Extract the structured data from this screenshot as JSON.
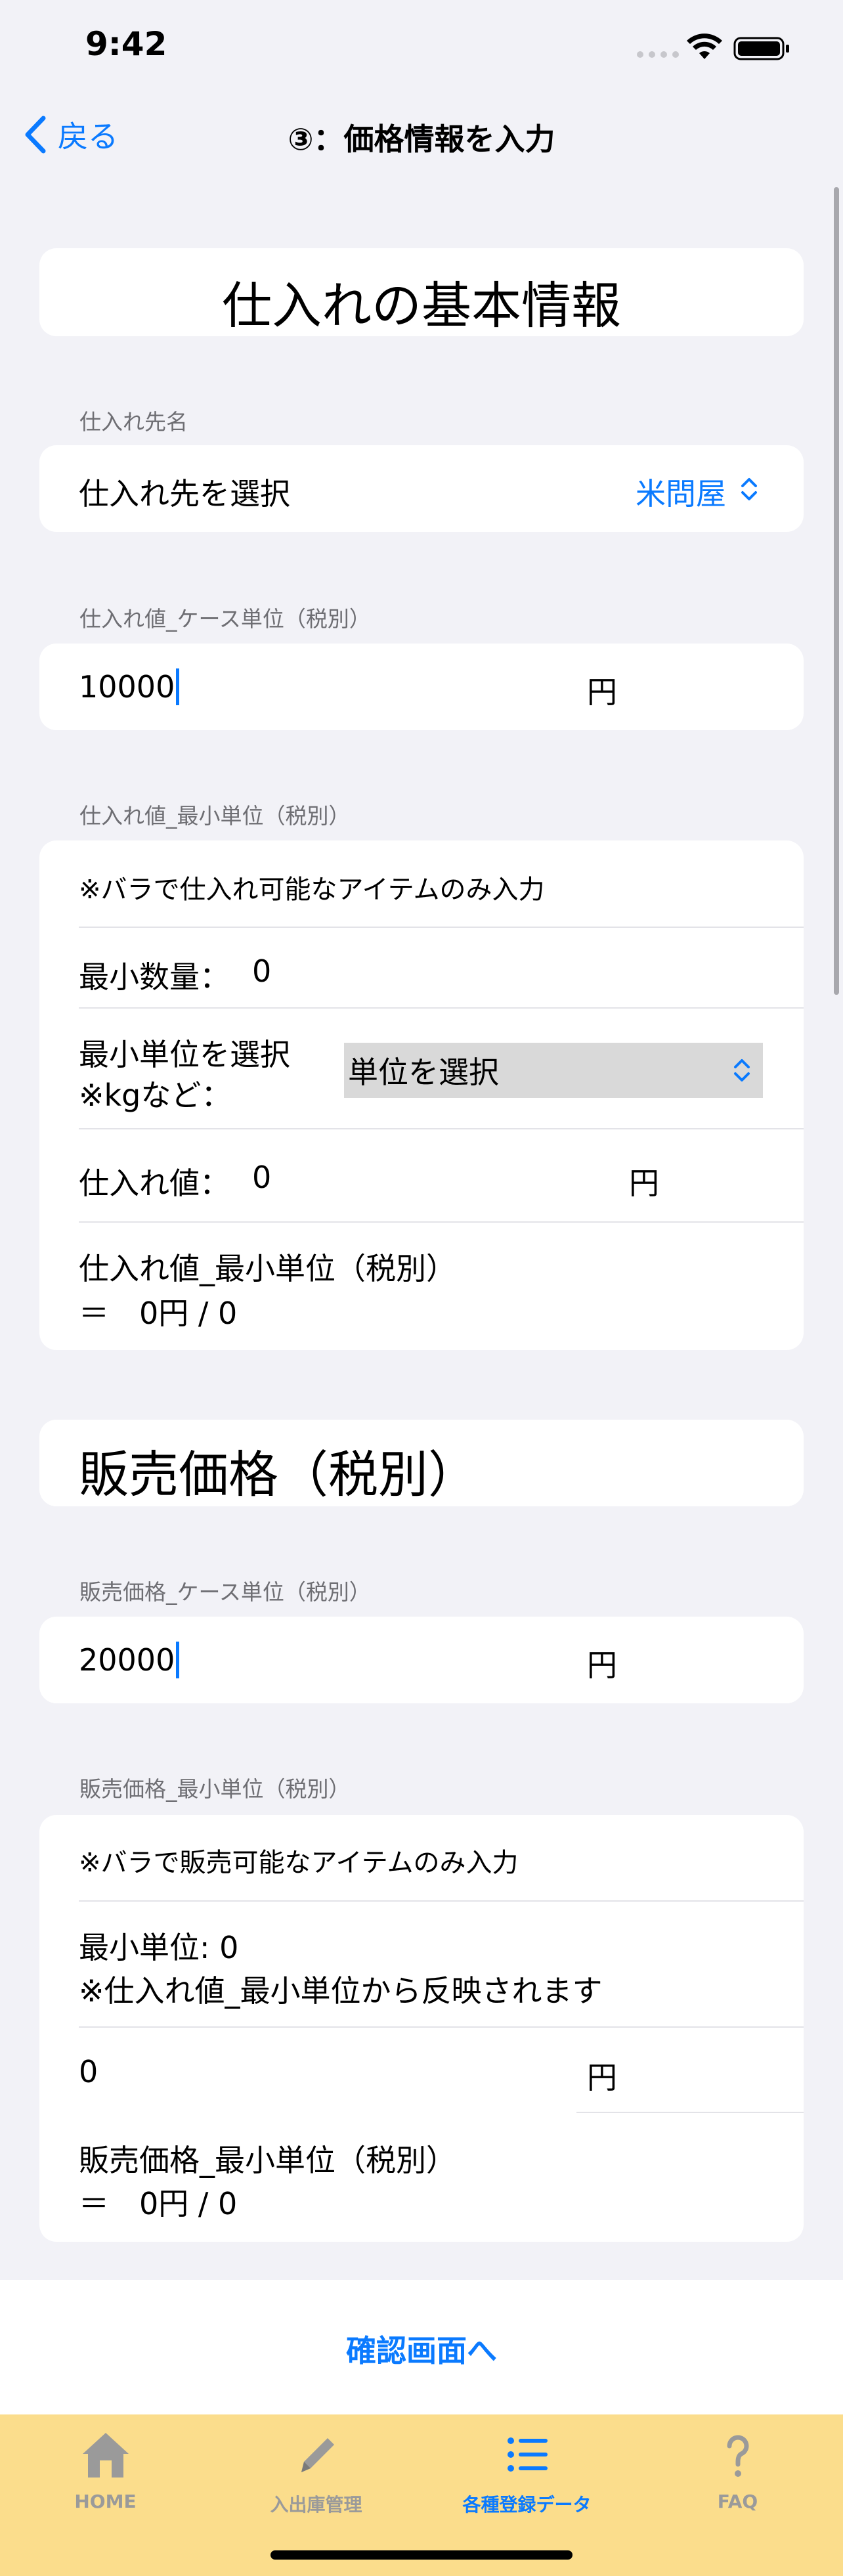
{
  "status_bar": {
    "time": "9:42"
  },
  "nav": {
    "back_label": "戻る",
    "title": "③：価格情報を入力"
  },
  "purchase": {
    "heading": "仕入れの基本情報",
    "supplier": {
      "header": "仕入れ先名",
      "label": "仕入れ先を選択",
      "value": "米問屋"
    },
    "case_price": {
      "header": "仕入れ値_ケース単位（税別）",
      "value": "10000",
      "unit": "円"
    },
    "min_unit": {
      "header": "仕入れ値_最小単位（税別）",
      "note": "※バラで仕入れ可能なアイテムのみ入力",
      "min_qty_label": "最小数量：",
      "min_qty_value": "0",
      "unit_select_label_1": "最小単位を選択",
      "unit_select_label_2": "※kgなど：",
      "unit_select_value": "単位を選択",
      "price_label": "仕入れ値：",
      "price_value": "0",
      "price_unit": "円",
      "result_label": "仕入れ値_最小単位（税別）",
      "result_value": "＝　0円 / 0"
    }
  },
  "sales": {
    "heading": "販売価格（税別）",
    "case_price": {
      "header": "販売価格_ケース単位（税別）",
      "value": "20000",
      "unit": "円"
    },
    "min_unit": {
      "header": "販売価格_最小単位（税別）",
      "note": "※バラで販売可能なアイテムのみ入力",
      "min_unit_line": "最小単位: 0",
      "reflect_note": "※仕入れ値_最小単位から反映されます",
      "price_value": "0",
      "price_unit": "円",
      "result_label": "販売価格_最小単位（税別）",
      "result_value": "＝　0円 / 0"
    }
  },
  "confirm_button": "確認画面へ",
  "tabs": [
    {
      "label": "HOME",
      "icon": "house-icon"
    },
    {
      "label": "入出庫管理",
      "icon": "pencil-icon"
    },
    {
      "label": "各種登録データ",
      "icon": "list-icon",
      "active": true
    },
    {
      "label": "FAQ",
      "icon": "question-icon"
    }
  ],
  "colors": {
    "accent": "#0a7aff",
    "tab_bar": "#fbdd8c",
    "background": "#f2f2f7"
  }
}
